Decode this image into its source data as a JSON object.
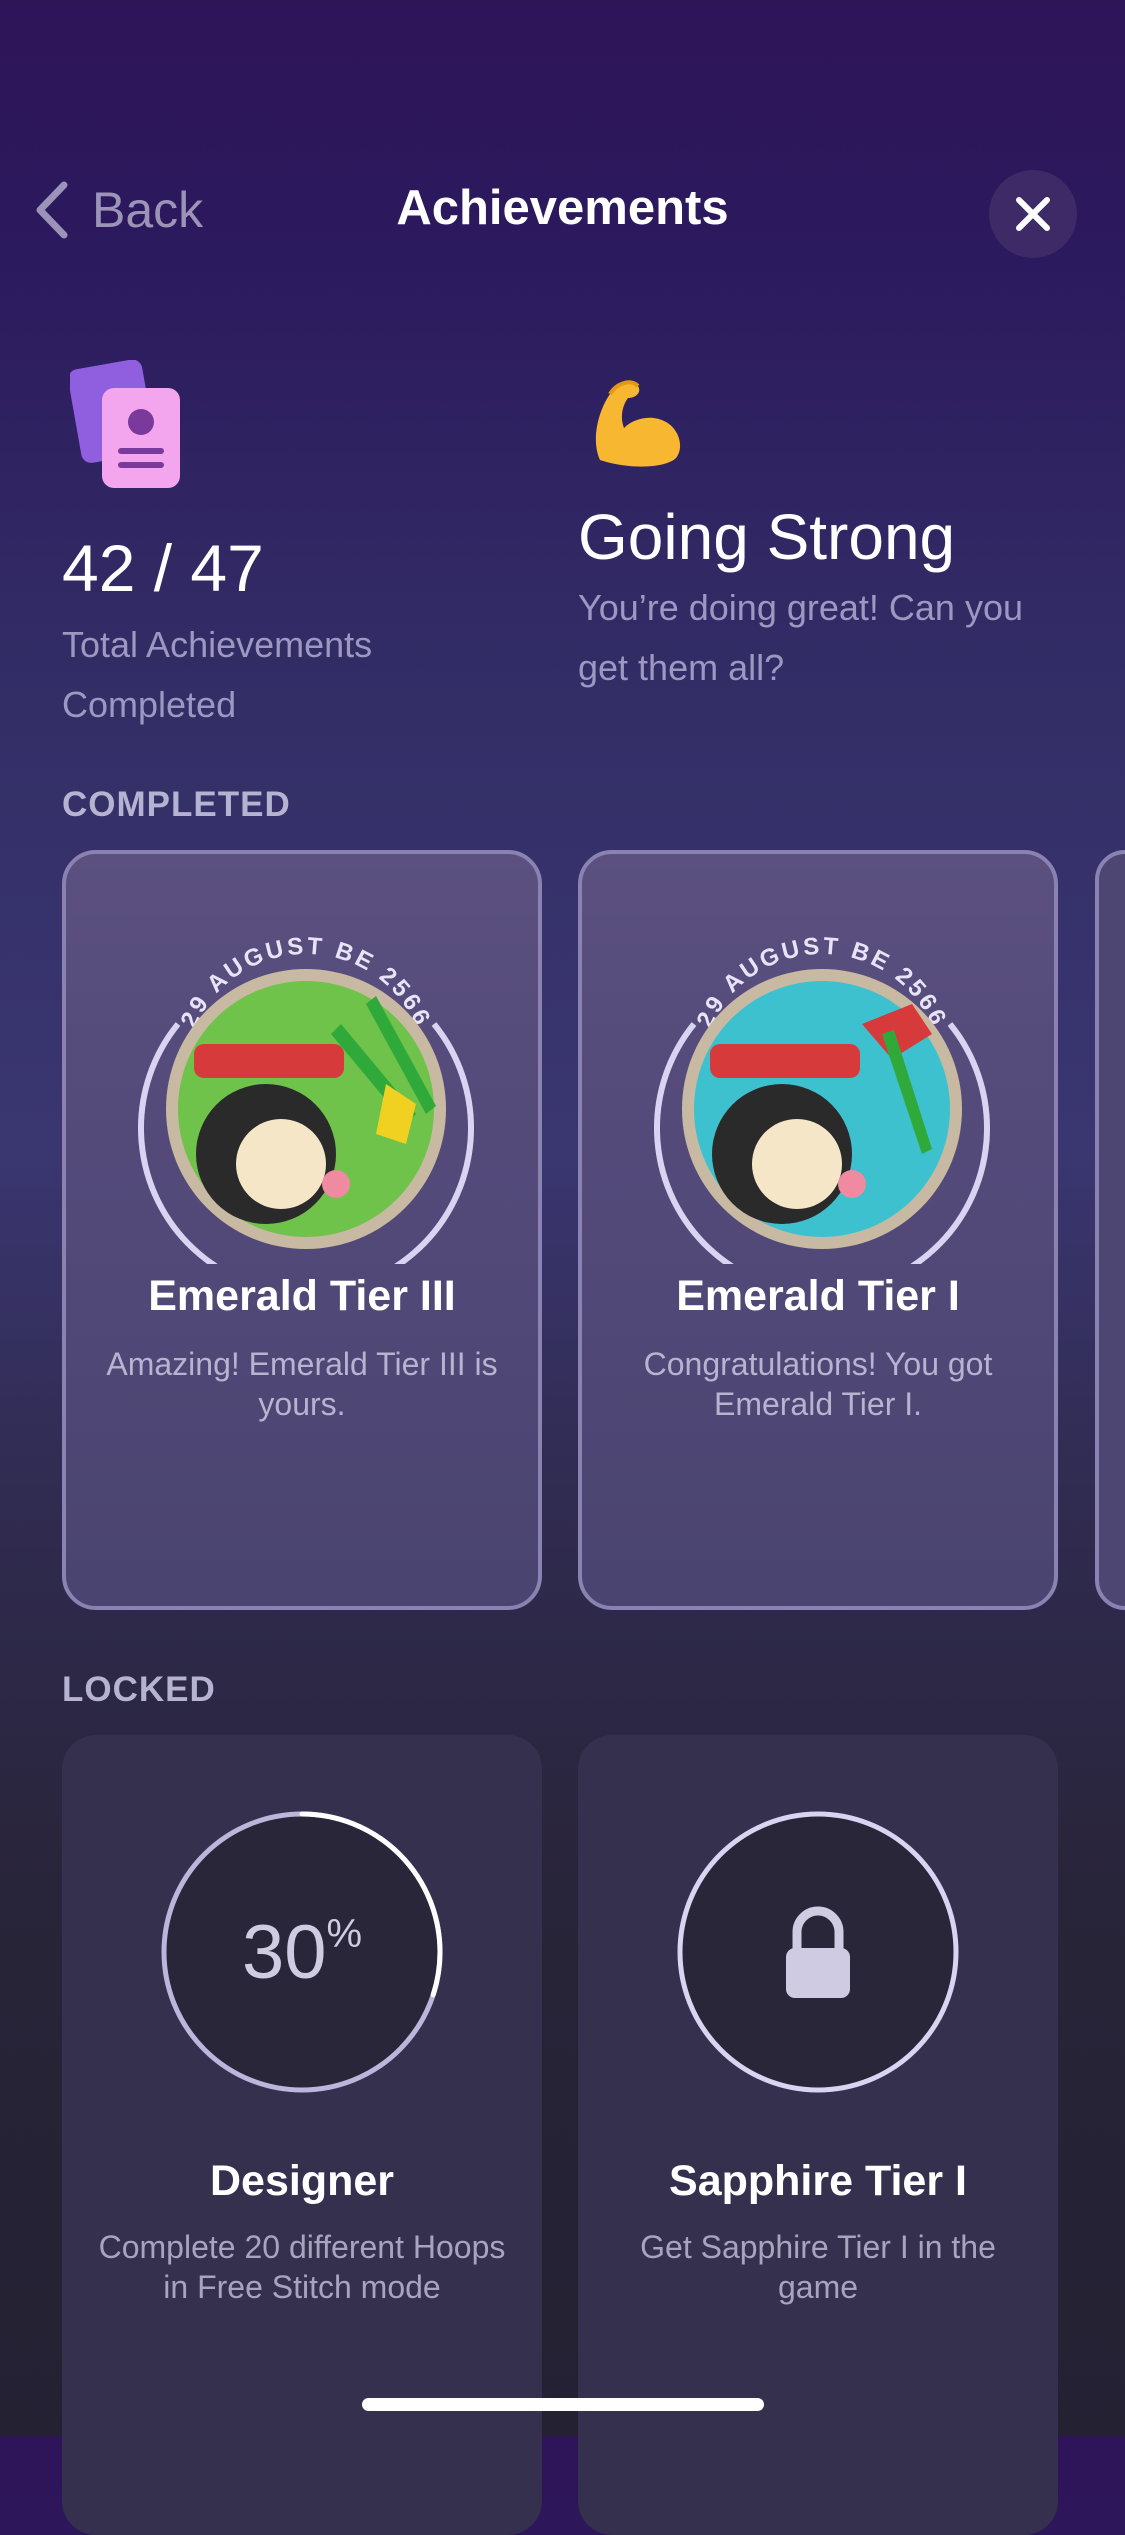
{
  "header": {
    "back_label": "Back",
    "title": "Achievements",
    "close_icon": "close-icon"
  },
  "summary": {
    "count": "42 / 47",
    "count_caption": "Total Achievements Completed",
    "status_emoji_icon": "flexed-biceps-icon",
    "status_title": "Going Strong",
    "status_text": "You’re doing great! Can you get them all?"
  },
  "completed": {
    "label": "COMPLETED",
    "items": [
      {
        "badge_date": "29 AUGUST BE 2566",
        "name": "Emerald Tier III",
        "description": "Amazing! Emerald Tier III is yours.",
        "badge_bg": "#6fc24a"
      },
      {
        "badge_date": "29 AUGUST BE 2566",
        "name": "Emerald Tier I",
        "description": "Congratulations! You got Emerald Tier I.",
        "badge_bg": "#3ec1cf"
      }
    ]
  },
  "locked": {
    "label": "LOCKED",
    "items": [
      {
        "progress_value": "30",
        "progress_unit": "%",
        "progress_fraction": 0.3,
        "name": "Designer",
        "description": "Complete 20 different Hoops in Free Stitch mode"
      },
      {
        "icon": "lock-icon",
        "name": "Sapphire Tier I",
        "description": "Get Sapphire Tier I in the game"
      }
    ]
  },
  "colors": {
    "accent_purple": "#c48cf5",
    "muted_text": "#9d98c2",
    "ring": "#d9d4f2"
  }
}
